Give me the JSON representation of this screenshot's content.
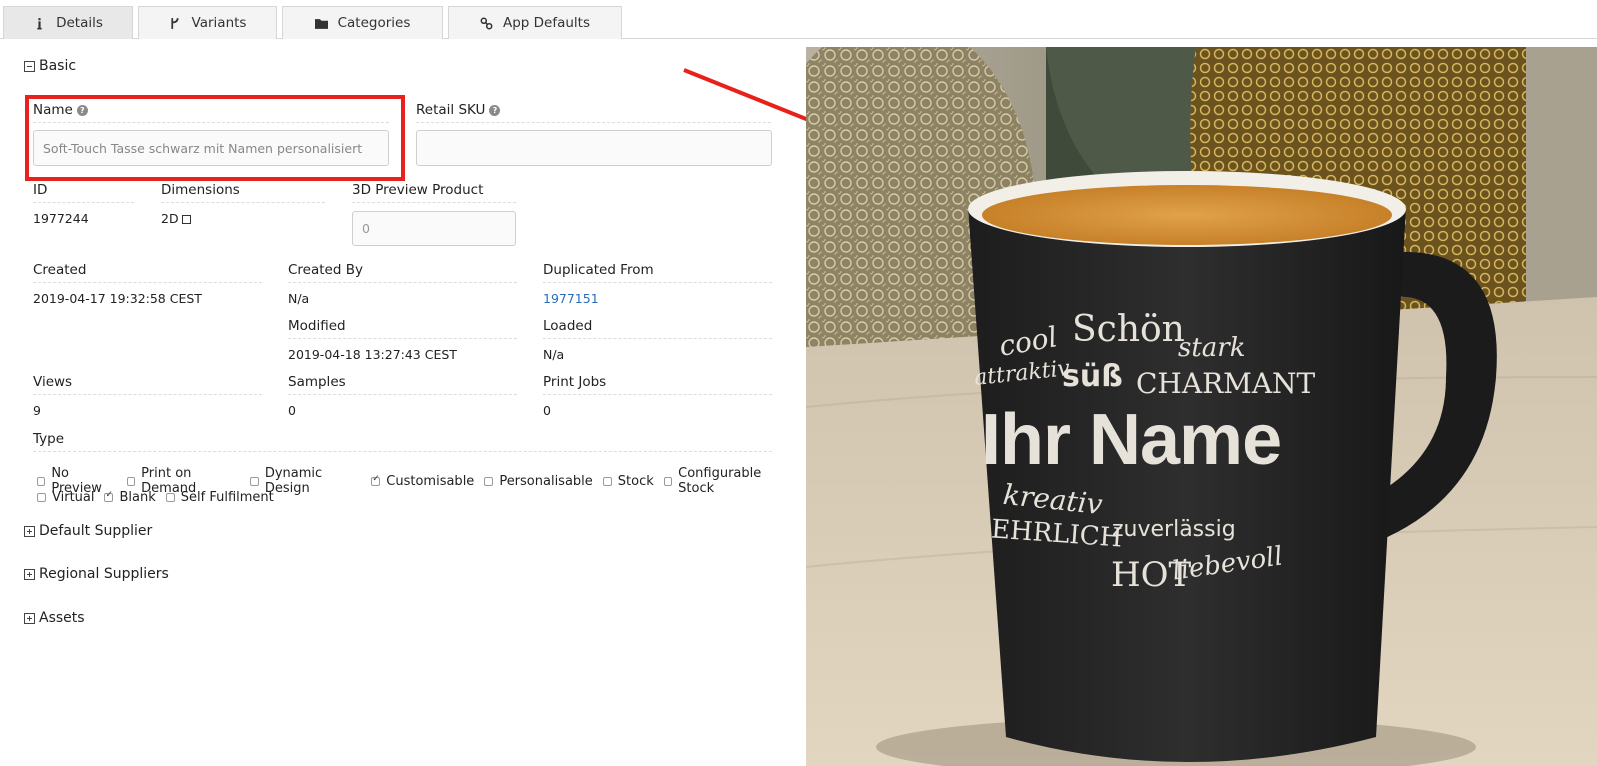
{
  "tabs": [
    {
      "label": "Details",
      "icon": "info-icon"
    },
    {
      "label": "Variants",
      "icon": "branch-icon"
    },
    {
      "label": "Categories",
      "icon": "folder-icon"
    },
    {
      "label": "App Defaults",
      "icon": "link-icon"
    }
  ],
  "sections": {
    "basic": "Basic",
    "default_supplier": "Default Supplier",
    "regional_suppliers": "Regional Suppliers",
    "assets": "Assets"
  },
  "name": {
    "label": "Name",
    "placeholder": "Soft-Touch Tasse schwarz mit Namen personalisiert"
  },
  "retail_sku": {
    "label": "Retail SKU",
    "value": ""
  },
  "id": {
    "label": "ID",
    "value": "1977244"
  },
  "dimensions": {
    "label": "Dimensions",
    "value": "2D"
  },
  "preview_3d": {
    "label": "3D Preview Product",
    "placeholder": "0"
  },
  "created": {
    "label": "Created",
    "value": "2019-04-17 19:32:58 CEST"
  },
  "created_by": {
    "label": "Created By",
    "value": "N/a"
  },
  "duplicated_from": {
    "label": "Duplicated From",
    "value": "1977151"
  },
  "modified": {
    "label": "Modified",
    "value": "2019-04-18 13:27:43 CEST"
  },
  "loaded": {
    "label": "Loaded",
    "value": "N/a"
  },
  "views": {
    "label": "Views",
    "value": "9"
  },
  "samples": {
    "label": "Samples",
    "value": "0"
  },
  "print_jobs": {
    "label": "Print Jobs",
    "value": "0"
  },
  "type": {
    "label": "Type",
    "options_row1": [
      {
        "label": "No Preview",
        "checked": false
      },
      {
        "label": "Print on Demand",
        "checked": false
      },
      {
        "label": "Dynamic Design",
        "checked": false
      },
      {
        "label": "Customisable",
        "checked": true
      },
      {
        "label": "Personalisable",
        "checked": false
      },
      {
        "label": "Stock",
        "checked": false
      },
      {
        "label": "Configurable Stock",
        "checked": false
      }
    ],
    "options_row2": [
      {
        "label": "Virtual",
        "checked": false
      },
      {
        "label": "Blank",
        "checked": true
      },
      {
        "label": "Self Fulfilment",
        "checked": false
      }
    ]
  },
  "mug": {
    "words": [
      "cool",
      "Schön",
      "stark",
      "attraktiv",
      "süß",
      "CHARMANT",
      "Ihr Name",
      "kreativ",
      "zuverlässig",
      "EHRLICH",
      "HOT",
      "liebevoll"
    ]
  },
  "colors": {
    "highlight": "#e8211c",
    "link": "#2a6ebb"
  }
}
